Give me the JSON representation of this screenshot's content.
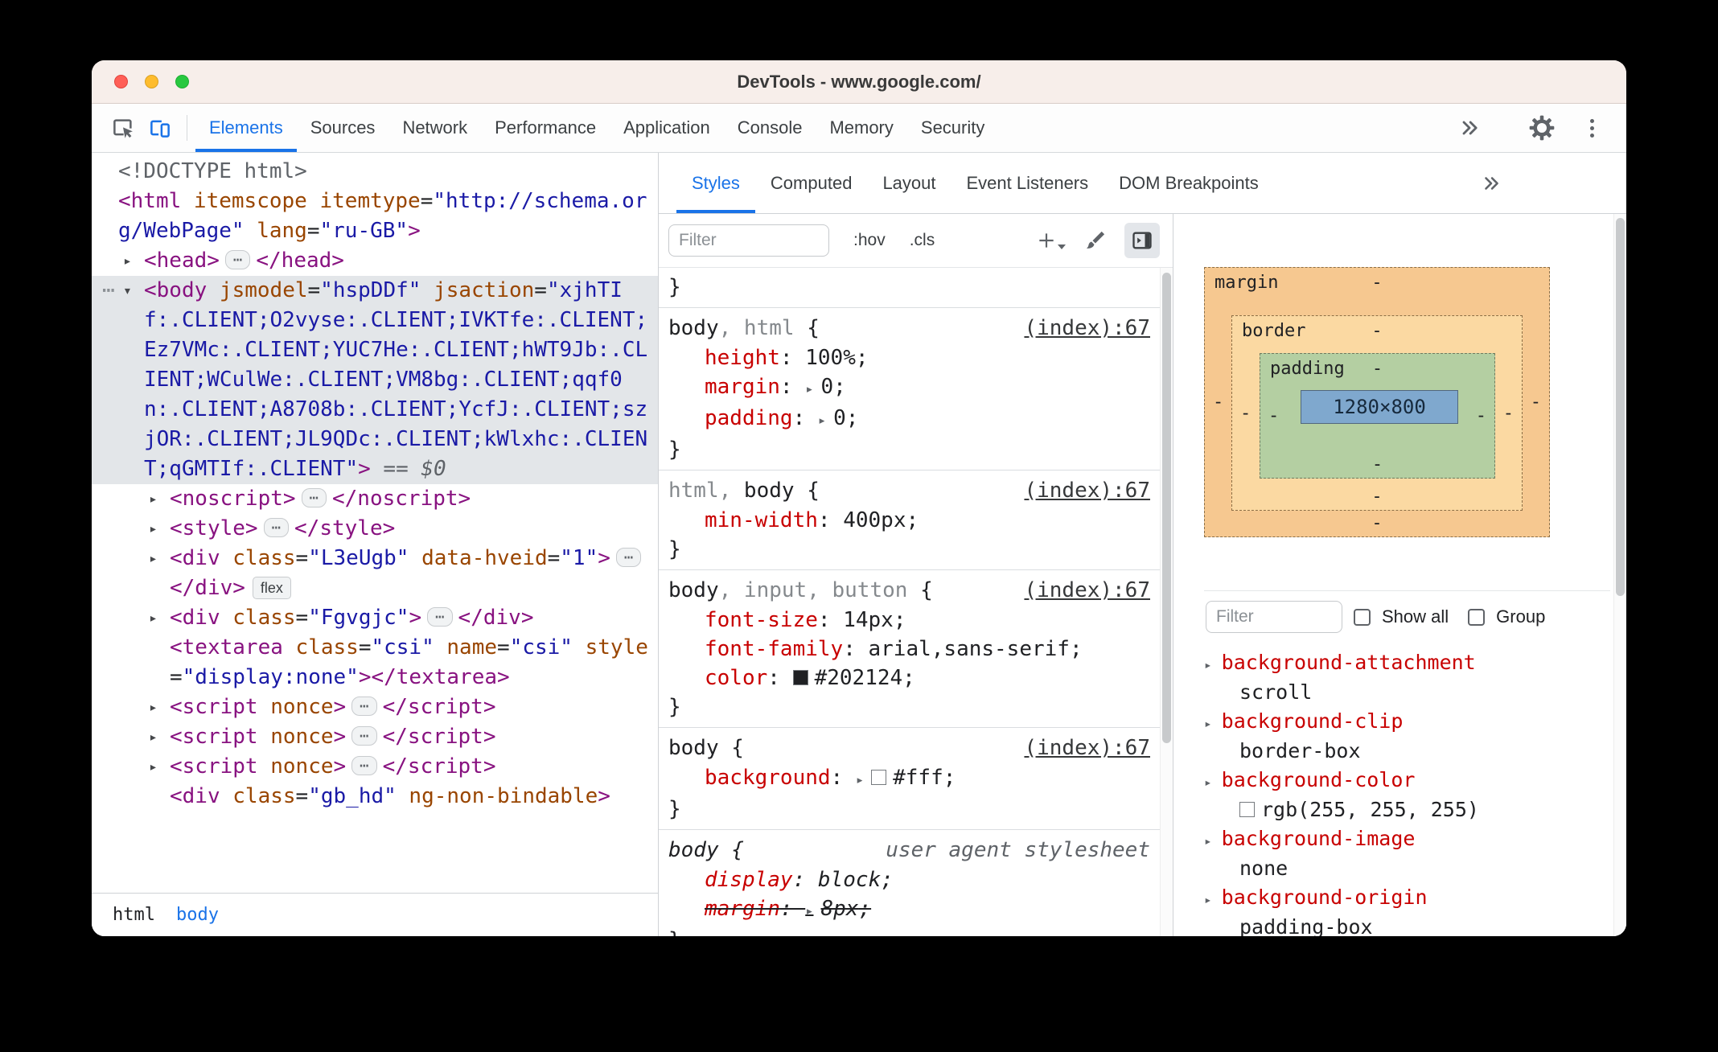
{
  "window": {
    "title": "DevTools - www.google.com/"
  },
  "toolbar": {
    "tabs": [
      "Elements",
      "Sources",
      "Network",
      "Performance",
      "Application",
      "Console",
      "Memory",
      "Security"
    ],
    "active_tab": "Elements"
  },
  "elements_panel": {
    "breadcrumb": {
      "items": [
        "html",
        "body"
      ],
      "selected": "body"
    },
    "dom_tree": [
      {
        "name": "doctype",
        "indent": 0,
        "tokens": [
          {
            "t": "doctype",
            "s": "<!DOCTYPE html>"
          }
        ]
      },
      {
        "name": "html",
        "indent": 0,
        "tokens": [
          {
            "t": "tag",
            "s": "<html"
          },
          {
            "t": "attr",
            "s": " itemscope"
          },
          {
            "t": "attr",
            "s": " itemtype"
          },
          {
            "t": "plain",
            "s": "="
          },
          {
            "t": "val",
            "s": "\"http://schema.org/WebPage\""
          },
          {
            "t": "attr",
            "s": " lang"
          },
          {
            "t": "plain",
            "s": "="
          },
          {
            "t": "val",
            "s": "\"ru-GB\""
          },
          {
            "t": "tag",
            "s": ">"
          }
        ]
      },
      {
        "name": "head",
        "indent": 1,
        "arrow": "closed",
        "tokens": [
          {
            "t": "tag",
            "s": "<head>"
          },
          {
            "t": "pill"
          },
          {
            "t": "tag",
            "s": "</head>"
          }
        ]
      },
      {
        "name": "body",
        "indent": 1,
        "arrow": "open",
        "selected": true,
        "gutter_dots": true,
        "tokens": [
          {
            "t": "tag",
            "s": "<body"
          },
          {
            "t": "attr",
            "s": " jsmodel"
          },
          {
            "t": "plain",
            "s": "="
          },
          {
            "t": "val",
            "s": "\"hspDDf\""
          },
          {
            "t": "attr",
            "s": " jsaction"
          },
          {
            "t": "plain",
            "s": "="
          },
          {
            "t": "val",
            "s": "\"xjhTIf:.CLIENT;O2vyse:.CLIENT;IVKTfe:.CLIENT;Ez7VMc:.CLIENT;YUC7He:.CLIENT;hWT9Jb:.CLIENT;WCulWe:.CLIENT;VM8bg:.CLIENT;qqf0n:.CLIENT;A8708b:.CLIENT;YcfJ:.CLIENT;szjOR:.CLIENT;JL9QDc:.CLIENT;kWlxhc:.CLIENT;qGMTIf:.CLIENT\""
          },
          {
            "t": "tag",
            "s": ">"
          },
          {
            "t": "note",
            "s": " == $0"
          }
        ]
      },
      {
        "name": "noscript",
        "indent": 2,
        "arrow": "closed",
        "tokens": [
          {
            "t": "tag",
            "s": "<noscript>"
          },
          {
            "t": "pill"
          },
          {
            "t": "tag",
            "s": "</noscript>"
          }
        ]
      },
      {
        "name": "style",
        "indent": 2,
        "arrow": "closed",
        "tokens": [
          {
            "t": "tag",
            "s": "<style>"
          },
          {
            "t": "pill"
          },
          {
            "t": "tag",
            "s": "</style>"
          }
        ]
      },
      {
        "name": "div-l3eugb",
        "indent": 2,
        "arrow": "closed",
        "tokens": [
          {
            "t": "tag",
            "s": "<div"
          },
          {
            "t": "attr",
            "s": " class"
          },
          {
            "t": "plain",
            "s": "="
          },
          {
            "t": "val",
            "s": "\"L3eUgb\""
          },
          {
            "t": "attr",
            "s": " data-hveid"
          },
          {
            "t": "plain",
            "s": "="
          },
          {
            "t": "val",
            "s": "\"1\""
          },
          {
            "t": "tag",
            "s": ">"
          },
          {
            "t": "pill"
          },
          {
            "t": "tag",
            "s": "</div>"
          },
          {
            "t": "badge",
            "s": "flex"
          }
        ]
      },
      {
        "name": "div-fgvgjc",
        "indent": 2,
        "arrow": "closed",
        "tokens": [
          {
            "t": "tag",
            "s": "<div"
          },
          {
            "t": "attr",
            "s": " class"
          },
          {
            "t": "plain",
            "s": "="
          },
          {
            "t": "val",
            "s": "\"Fgvgjc\""
          },
          {
            "t": "tag",
            "s": ">"
          },
          {
            "t": "pill"
          },
          {
            "t": "tag",
            "s": "</div>"
          }
        ]
      },
      {
        "name": "textarea-csi",
        "indent": 2,
        "tokens": [
          {
            "t": "tag",
            "s": "<textarea"
          },
          {
            "t": "attr",
            "s": " class"
          },
          {
            "t": "plain",
            "s": "="
          },
          {
            "t": "val",
            "s": "\"csi\""
          },
          {
            "t": "attr",
            "s": " name"
          },
          {
            "t": "plain",
            "s": "="
          },
          {
            "t": "val",
            "s": "\"csi\""
          },
          {
            "t": "attr",
            "s": " style"
          },
          {
            "t": "plain",
            "s": "="
          },
          {
            "t": "val",
            "s": "\"display:none\""
          },
          {
            "t": "tag",
            "s": "></textarea>"
          }
        ]
      },
      {
        "name": "script-1",
        "indent": 2,
        "arrow": "closed",
        "tokens": [
          {
            "t": "tag",
            "s": "<script"
          },
          {
            "t": "attr",
            "s": " nonce"
          },
          {
            "t": "tag",
            "s": ">"
          },
          {
            "t": "pill"
          },
          {
            "t": "tag",
            "s": "</script>"
          }
        ]
      },
      {
        "name": "script-2",
        "indent": 2,
        "arrow": "closed",
        "tokens": [
          {
            "t": "tag",
            "s": "<script"
          },
          {
            "t": "attr",
            "s": " nonce"
          },
          {
            "t": "tag",
            "s": ">"
          },
          {
            "t": "pill"
          },
          {
            "t": "tag",
            "s": "</script>"
          }
        ]
      },
      {
        "name": "script-3",
        "indent": 2,
        "arrow": "closed",
        "tokens": [
          {
            "t": "tag",
            "s": "<script"
          },
          {
            "t": "attr",
            "s": " nonce"
          },
          {
            "t": "tag",
            "s": ">"
          },
          {
            "t": "pill"
          },
          {
            "t": "tag",
            "s": "</script>"
          }
        ]
      },
      {
        "name": "div-gb-hd",
        "indent": 2,
        "tokens": [
          {
            "t": "tag",
            "s": "<div"
          },
          {
            "t": "attr",
            "s": " class"
          },
          {
            "t": "plain",
            "s": "="
          },
          {
            "t": "val",
            "s": "\"gb_hd\""
          },
          {
            "t": "attr",
            "s": " ng-non-bindable"
          },
          {
            "t": "tag",
            "s": ">"
          }
        ]
      }
    ]
  },
  "styles_panel": {
    "tabs": [
      "Styles",
      "Computed",
      "Layout",
      "Event Listeners",
      "DOM Breakpoints"
    ],
    "active_tab": "Styles",
    "filter_placeholder": "Filter",
    "pseudo_toggle": ":hov",
    "class_toggle": ".cls",
    "rules": [
      {
        "lone_close": true
      },
      {
        "selector": [
          {
            "text": "body"
          },
          {
            "text": ", html",
            "dim": true
          }
        ],
        "origin": "(index):67",
        "link": true,
        "props": [
          {
            "name": "height",
            "value": "100%"
          },
          {
            "name": "margin",
            "value": "0",
            "arrow": true
          },
          {
            "name": "padding",
            "value": "0",
            "arrow": true
          }
        ]
      },
      {
        "selector": [
          {
            "text": "html, ",
            "dim": true
          },
          {
            "text": "body"
          }
        ],
        "origin": "(index):67",
        "link": true,
        "props": [
          {
            "name": "min-width",
            "value": "400px"
          }
        ]
      },
      {
        "selector": [
          {
            "text": "body"
          },
          {
            "text": ", input, button",
            "dim": true
          }
        ],
        "origin": "(index):67",
        "link": true,
        "props": [
          {
            "name": "font-size",
            "value": "14px"
          },
          {
            "name": "font-family",
            "value": "arial,sans-serif"
          },
          {
            "name": "color",
            "value": "#202124",
            "swatch": "#202124"
          }
        ]
      },
      {
        "selector": [
          {
            "text": "body"
          }
        ],
        "origin": "(index):67",
        "link": true,
        "props": [
          {
            "name": "background",
            "value": "#fff",
            "arrow": true,
            "swatch": "#ffffff"
          }
        ]
      },
      {
        "selector": [
          {
            "text": "body"
          }
        ],
        "origin": "user agent stylesheet",
        "link": false,
        "italic": true,
        "props": [
          {
            "name": "display",
            "value": "block",
            "italic": true
          },
          {
            "name": "margin",
            "value": "8px",
            "arrow": true,
            "italic": true,
            "struck": true
          }
        ]
      }
    ]
  },
  "sidebar": {
    "box_model": {
      "margin_label": "margin",
      "border_label": "border",
      "padding_label": "padding",
      "content": "1280×800",
      "margin": {
        "top": "-",
        "right": "-",
        "bottom": "-",
        "left": "-"
      },
      "border": {
        "top": "-",
        "right": "-",
        "bottom": "-",
        "left": "-"
      },
      "padding": {
        "top": "-",
        "right": "-",
        "bottom": "-",
        "left": "-"
      }
    },
    "filter_placeholder": "Filter",
    "show_all_label": "Show all",
    "group_label": "Group",
    "properties": [
      {
        "name": "background-attachment",
        "value": "scroll"
      },
      {
        "name": "background-clip",
        "value": "border-box"
      },
      {
        "name": "background-color",
        "value": "rgb(255, 255, 255)",
        "swatch": "#ffffff"
      },
      {
        "name": "background-image",
        "value": "none"
      },
      {
        "name": "background-origin",
        "value": "padding-box"
      }
    ]
  }
}
